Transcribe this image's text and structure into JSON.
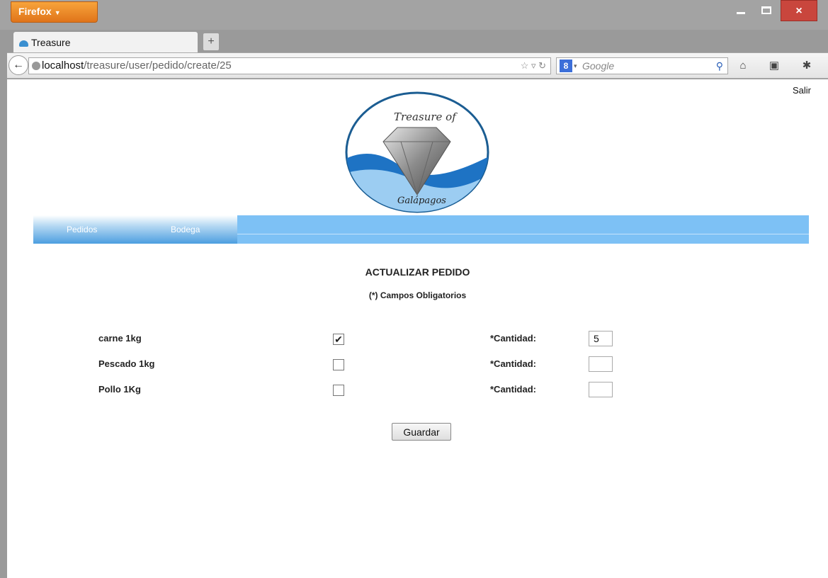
{
  "browser": {
    "menu_button": "Firefox",
    "tab_title": "Treasure",
    "new_tab": "+",
    "url_host": "localhost",
    "url_path": "/treasure/user/pedido/create/25",
    "search_placeholder": "Google",
    "window_controls": {
      "minimize": "",
      "maximize": "",
      "close": "×"
    }
  },
  "page": {
    "logout": "Salir",
    "logo": {
      "line1": "Treasure of",
      "line2": "Galápagos"
    },
    "menu": [
      "Pedidos",
      "Bodega"
    ],
    "title": "ACTUALIZAR PEDIDO",
    "subtitle": "(*) Campos Obligatorios",
    "items": [
      {
        "name": "carne 1kg",
        "checked": true,
        "qty_label": "*Cantidad:",
        "qty": "5"
      },
      {
        "name": "Pescado 1kg",
        "checked": false,
        "qty_label": "*Cantidad:",
        "qty": ""
      },
      {
        "name": "Pollo 1Kg",
        "checked": false,
        "qty_label": "*Cantidad:",
        "qty": ""
      }
    ],
    "save_button": "Guardar"
  },
  "colors": {
    "menubar": "#7dc1f5",
    "firefox_orange": "#e0741a",
    "close_red": "#c9463d"
  }
}
